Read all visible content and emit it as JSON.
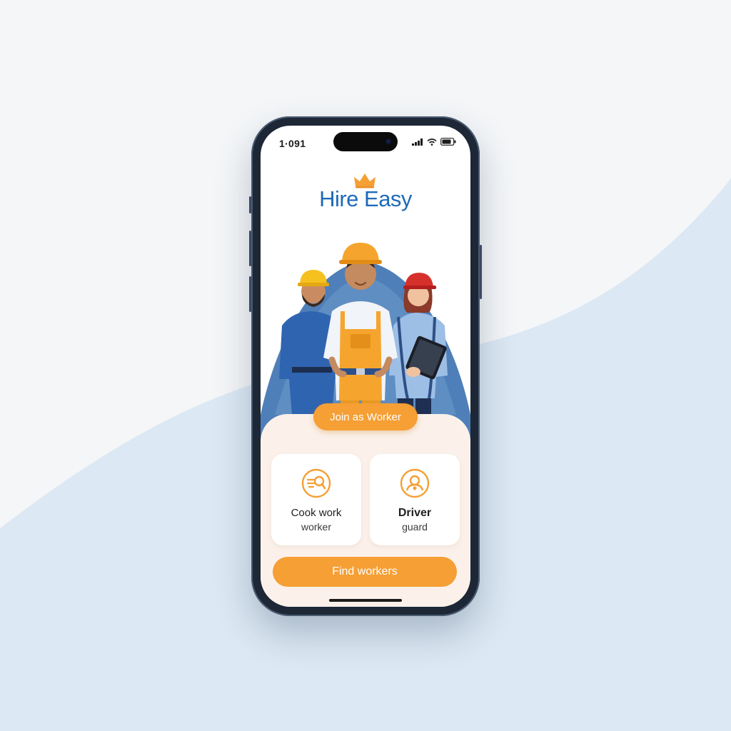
{
  "status_bar": {
    "time": "1·091"
  },
  "app": {
    "title": "Hire Easy"
  },
  "buttons": {
    "join": "Join as Worker",
    "find": "Find workers"
  },
  "categories": [
    {
      "title": "Cook work",
      "subtitle": "worker",
      "icon": "cook-tools-icon"
    },
    {
      "title": "Driver",
      "subtitle": "guard",
      "icon": "driver-person-icon"
    }
  ],
  "colors": {
    "accent": "#f59f34",
    "brand_blue": "#1f6ab8",
    "panel": "#fbf1ea",
    "background_wave": "#dce8f3"
  }
}
